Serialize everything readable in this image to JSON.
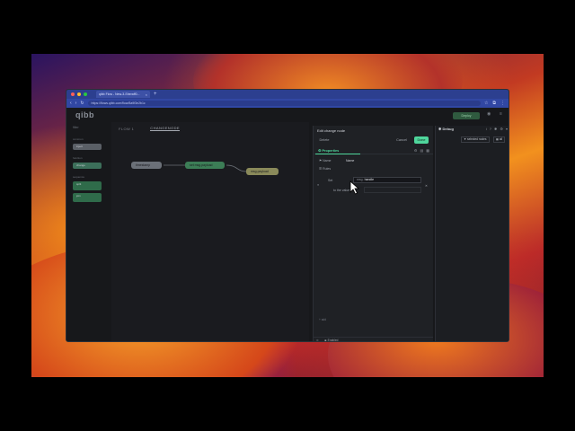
{
  "browser": {
    "tab_title": "qibb Flow - New-3-Sheraff0...",
    "tab_add": "+",
    "tab_close": "×",
    "url": "https://flows.qibb.com/flow/8a9f3e2b1c",
    "nav": {
      "back": "‹",
      "forward": "›",
      "reload": "↻"
    },
    "window_dot_colors": [
      "#ff5f57",
      "#febc2e",
      "#28c840"
    ]
  },
  "app": {
    "logo": "qibb",
    "deploy_label": "Deploy"
  },
  "palette": {
    "search": "filter",
    "categories": [
      {
        "label": "common",
        "nodes": [
          {
            "label": "inject",
            "color": "#5a5f66"
          }
        ]
      },
      {
        "label": "function",
        "nodes": [
          {
            "label": "change",
            "color": "#3c6f5a"
          }
        ]
      },
      {
        "label": "sequence",
        "nodes": [
          {
            "label": "split",
            "color": "#2f6b4a"
          },
          {
            "label": "join",
            "color": "#2f6b4a"
          }
        ]
      }
    ]
  },
  "workspace": {
    "tabs": [
      "FLOW 1",
      "CHANGENODE"
    ],
    "active_tab": 1,
    "nodes": [
      {
        "label": "timestamp",
        "color": "#6b7078"
      },
      {
        "label": "set msg.payload",
        "color": "#3c7d56"
      },
      {
        "label": "msg.payload",
        "color": "#8a8a5a"
      }
    ]
  },
  "editor": {
    "title": "Edit change node",
    "delete_label": "Delete",
    "cancel_label": "Cancel",
    "done_label": "Done",
    "tab_properties": "Properties",
    "name_label": "Name",
    "name_value": "Name",
    "rules_label": "Rules",
    "rule_action": "Set",
    "rule_prop_prefix": "msg.",
    "rule_prop_value": "handle",
    "rule_to_label": "to the value",
    "add_label": "+ add",
    "enabled_label": "Enabled"
  },
  "sidebar": {
    "tab_label": "Debug",
    "filter_label": "selected nodes",
    "clear_label": "all"
  },
  "colors": {
    "accent": "#4fd69c",
    "done_bg": "#4fd69c",
    "titlebar": "#2c3f8f"
  }
}
